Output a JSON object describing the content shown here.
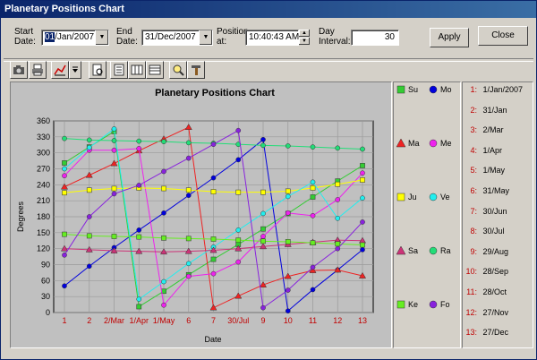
{
  "window": {
    "title": "Planetary Positions Chart"
  },
  "controls": {
    "start_date_label": "Start Date:",
    "start_date_value_sel": "01",
    "start_date_value_rest": "/Jan/2007",
    "end_date_label": "End Date:",
    "end_date_value": "31/Dec/2007",
    "position_label": "Position at:",
    "position_value": "10:40:43 AM",
    "day_interval_label": "Day Interval:",
    "day_interval_value": "30",
    "apply_label": "Apply",
    "close_label": "Close"
  },
  "toolbar": {
    "icons": [
      "camera-icon",
      "print-icon",
      "chart-type-icon",
      "dropdown-arrow-icon",
      "print-preview-icon",
      "data-sheet-icon",
      "columns-icon",
      "rows-icon",
      "zoom-icon",
      "tools-icon"
    ]
  },
  "chart_data": {
    "type": "line",
    "title": "Planetary Positions Chart",
    "xlabel": "Date",
    "ylabel": "Degrees",
    "ylim": [
      0,
      360
    ],
    "yticks": [
      0,
      30,
      60,
      90,
      120,
      150,
      180,
      210,
      240,
      270,
      300,
      330,
      360
    ],
    "x": [
      1,
      2,
      3,
      4,
      5,
      6,
      7,
      8,
      9,
      10,
      11,
      12,
      13
    ],
    "x_tick_labels": [
      "1",
      "2",
      "2/Mar",
      "1/Apr",
      "1/May",
      "6",
      "7",
      "30/Jul",
      "9",
      "10",
      "11",
      "12",
      "13"
    ],
    "grid": true,
    "series": [
      {
        "name": "Su",
        "color": "#33cc33",
        "marker": "square",
        "values": [
          281,
          311,
          340,
          11,
          40,
          71,
          100,
          128,
          157,
          186,
          217,
          247,
          276
        ]
      },
      {
        "name": "Mo",
        "color": "#0000dd",
        "marker": "circle",
        "values": [
          50,
          87,
          122,
          155,
          187,
          220,
          253,
          287,
          325,
          3,
          43,
          80,
          118
        ]
      },
      {
        "name": "Ma",
        "color": "#ee2222",
        "marker": "triangle",
        "values": [
          236,
          258,
          280,
          304,
          326,
          348,
          9,
          31,
          52,
          68,
          79,
          80,
          69
        ]
      },
      {
        "name": "Me",
        "color": "#ee22ee",
        "marker": "circle",
        "values": [
          257,
          305,
          305,
          308,
          14,
          68,
          73,
          95,
          143,
          187,
          182,
          212,
          262
        ]
      },
      {
        "name": "Ju",
        "color": "#ffff00",
        "marker": "square",
        "values": [
          225,
          230,
          233,
          234,
          233,
          230,
          227,
          226,
          226,
          228,
          234,
          241,
          249
        ]
      },
      {
        "name": "Ve",
        "color": "#22eeee",
        "marker": "circle",
        "values": [
          270,
          310,
          345,
          25,
          58,
          92,
          123,
          155,
          186,
          218,
          245,
          177,
          215
        ]
      },
      {
        "name": "Sa",
        "color": "#cc3377",
        "marker": "triangle",
        "values": [
          120,
          118,
          116,
          115,
          114,
          115,
          117,
          120,
          124,
          128,
          132,
          136,
          135
        ]
      },
      {
        "name": "Ra",
        "color": "#22dd77",
        "marker": "circle",
        "values": [
          327,
          324,
          323,
          322,
          321,
          319,
          318,
          316,
          314,
          313,
          311,
          309,
          307
        ]
      },
      {
        "name": "Ke",
        "color": "#66ee22",
        "marker": "square",
        "values": [
          147,
          144,
          143,
          142,
          140,
          139,
          138,
          136,
          134,
          133,
          131,
          129,
          127
        ]
      },
      {
        "name": "Fo",
        "color": "#8822dd",
        "marker": "circle",
        "values": [
          108,
          180,
          223,
          239,
          265,
          290,
          316,
          342,
          9,
          42,
          85,
          120,
          170
        ]
      }
    ]
  },
  "dates": [
    {
      "n": "1:",
      "d": "1/Jan/2007"
    },
    {
      "n": "2:",
      "d": "31/Jan"
    },
    {
      "n": "3:",
      "d": "2/Mar"
    },
    {
      "n": "4:",
      "d": "1/Apr"
    },
    {
      "n": "5:",
      "d": "1/May"
    },
    {
      "n": "6:",
      "d": "31/May"
    },
    {
      "n": "7:",
      "d": "30/Jun"
    },
    {
      "n": "8:",
      "d": "30/Jul"
    },
    {
      "n": "9:",
      "d": "29/Aug"
    },
    {
      "n": "10:",
      "d": "28/Sep"
    },
    {
      "n": "11:",
      "d": "28/Oct"
    },
    {
      "n": "12:",
      "d": "27/Nov"
    },
    {
      "n": "13:",
      "d": "27/Dec"
    }
  ]
}
